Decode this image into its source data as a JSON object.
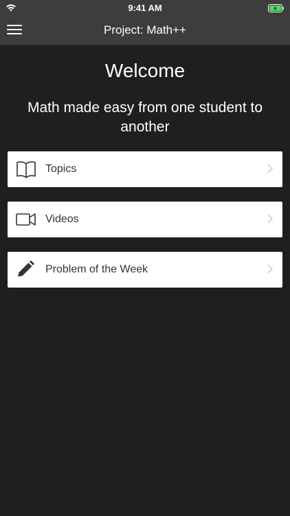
{
  "status_bar": {
    "time": "9:41 AM",
    "wifi_icon": "wifi-icon",
    "battery_icon": "battery-charging-icon"
  },
  "nav": {
    "title": "Project: Math++",
    "menu_icon": "hamburger-menu-icon"
  },
  "main": {
    "welcome": "Welcome",
    "subtitle": "Math made easy from one student to another"
  },
  "menu_items": [
    {
      "label": "Topics",
      "icon": "book-icon"
    },
    {
      "label": "Videos",
      "icon": "video-camera-icon"
    },
    {
      "label": "Problem of the Week",
      "icon": "pencil-icon"
    }
  ],
  "colors": {
    "background": "#1f1f1f",
    "bar": "#3d3d3d",
    "card": "#ffffff",
    "card_text": "#333333",
    "battery_green": "#4cd964"
  }
}
